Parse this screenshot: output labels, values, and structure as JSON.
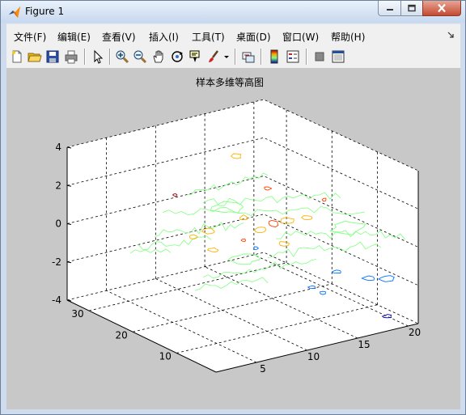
{
  "window": {
    "title": "Figure 1"
  },
  "menu": [
    "文件(F)",
    "编辑(E)",
    "查看(V)",
    "插入(I)",
    "工具(T)",
    "桌面(D)",
    "窗口(W)",
    "帮助(H)"
  ],
  "toolbar": [
    "new-figure",
    "open-file",
    "save-figure",
    "print-figure",
    "edit-plot",
    "zoom-in",
    "zoom-out",
    "pan",
    "rotate-3d",
    "data-cursor",
    "brush",
    "link-plot",
    "insert-colorbar",
    "insert-legend",
    "hide-plot-tools",
    "show-plot-tools"
  ],
  "chart_data": {
    "type": "contour3",
    "title": "样本多维等高图",
    "z_ticks": [
      "4",
      "2",
      "0",
      "-2",
      "-4"
    ],
    "x_ticks": [
      "5",
      "10",
      "15",
      "20"
    ],
    "y_ticks": [
      "10",
      "20",
      "30"
    ],
    "zlim": [
      -4,
      4
    ],
    "xlim": [
      1,
      21
    ],
    "ylim": [
      1,
      35
    ],
    "grid": true,
    "colormap": [
      "#0000a0",
      "#0070ff",
      "#00c8ff",
      "#80ff80",
      "#ffb000",
      "#ff4000",
      "#a00000"
    ]
  }
}
